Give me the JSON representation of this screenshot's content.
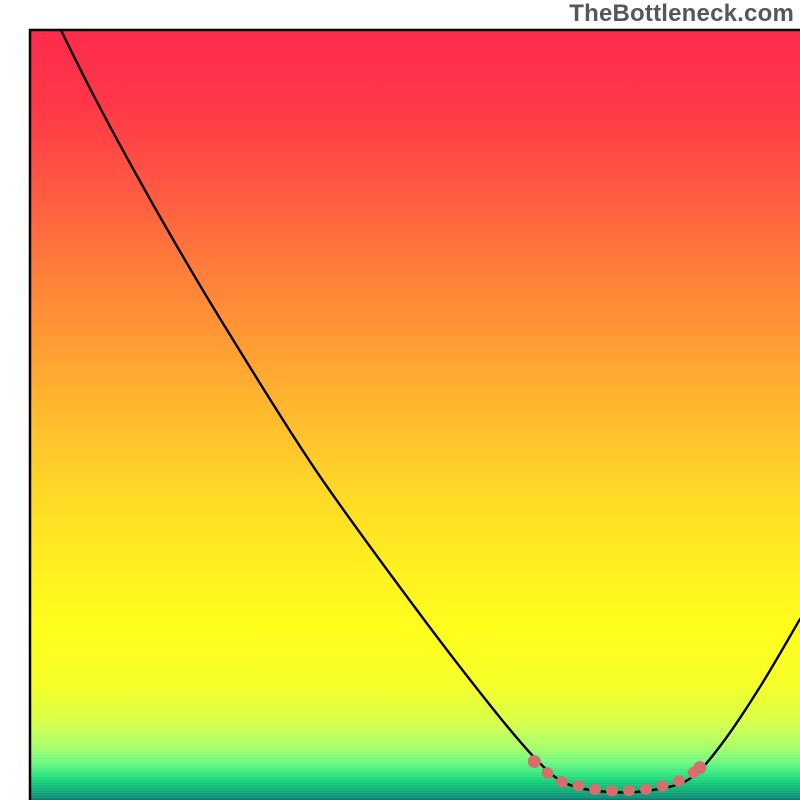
{
  "watermark": "TheBottleneck.com",
  "chart_data": {
    "type": "line",
    "title": "",
    "xlabel": "",
    "ylabel": "",
    "xlim": [
      0,
      100
    ],
    "ylim": [
      0,
      100
    ],
    "grid": false,
    "axes_visible": false,
    "background_gradient": {
      "bands": [
        {
          "y": 0,
          "color": "#ff2b4d"
        },
        {
          "y": 10,
          "color": "#ff3848"
        },
        {
          "y": 20,
          "color": "#ff5742"
        },
        {
          "y": 30,
          "color": "#ff7a3b"
        },
        {
          "y": 40,
          "color": "#ff9a34"
        },
        {
          "y": 50,
          "color": "#ffbb2e"
        },
        {
          "y": 60,
          "color": "#ffd827"
        },
        {
          "y": 70,
          "color": "#fff021"
        },
        {
          "y": 78,
          "color": "#ffff1c"
        },
        {
          "y": 85,
          "color": "#f6ff2a"
        },
        {
          "y": 90,
          "color": "#d6ff4a"
        },
        {
          "y": 93,
          "color": "#a8ff66"
        },
        {
          "y": 95,
          "color": "#72f97e"
        },
        {
          "y": 96.5,
          "color": "#34e97c"
        },
        {
          "y": 97.5,
          "color": "#14d27a"
        },
        {
          "y": 98.2,
          "color": "#0fbf7a"
        },
        {
          "y": 98.8,
          "color": "#0eab77"
        },
        {
          "y": 99.3,
          "color": "#0d9b77"
        },
        {
          "y": 99.7,
          "color": "#0a8c74"
        },
        {
          "y": 100,
          "color": "#037d6f"
        }
      ]
    },
    "series": [
      {
        "name": "bottleneck-curve",
        "color": "#000000",
        "points": [
          {
            "x": 4.0,
            "y": 100.0
          },
          {
            "x": 8.0,
            "y": 92.0
          },
          {
            "x": 12.0,
            "y": 84.5
          },
          {
            "x": 18.0,
            "y": 73.8
          },
          {
            "x": 25.0,
            "y": 62.0
          },
          {
            "x": 37.0,
            "y": 43.0
          },
          {
            "x": 50.0,
            "y": 25.0
          },
          {
            "x": 60.0,
            "y": 12.0
          },
          {
            "x": 66.0,
            "y": 5.0
          },
          {
            "x": 70.0,
            "y": 2.0
          },
          {
            "x": 76.0,
            "y": 1.0
          },
          {
            "x": 82.0,
            "y": 1.5
          },
          {
            "x": 86.0,
            "y": 3.0
          },
          {
            "x": 90.0,
            "y": 7.5
          },
          {
            "x": 95.0,
            "y": 15.0
          },
          {
            "x": 100.0,
            "y": 23.5
          }
        ]
      },
      {
        "name": "flat-zone-highlight",
        "color": "#d66f6c",
        "style": "dotted-thick",
        "points": [
          {
            "x": 65.5,
            "y": 5.0
          },
          {
            "x": 68.5,
            "y": 2.6
          },
          {
            "x": 71.5,
            "y": 1.8
          },
          {
            "x": 74.0,
            "y": 1.3
          },
          {
            "x": 77.0,
            "y": 1.2
          },
          {
            "x": 80.0,
            "y": 1.4
          },
          {
            "x": 82.5,
            "y": 1.9
          },
          {
            "x": 85.0,
            "y": 2.8
          },
          {
            "x": 87.0,
            "y": 4.2
          }
        ]
      }
    ]
  }
}
